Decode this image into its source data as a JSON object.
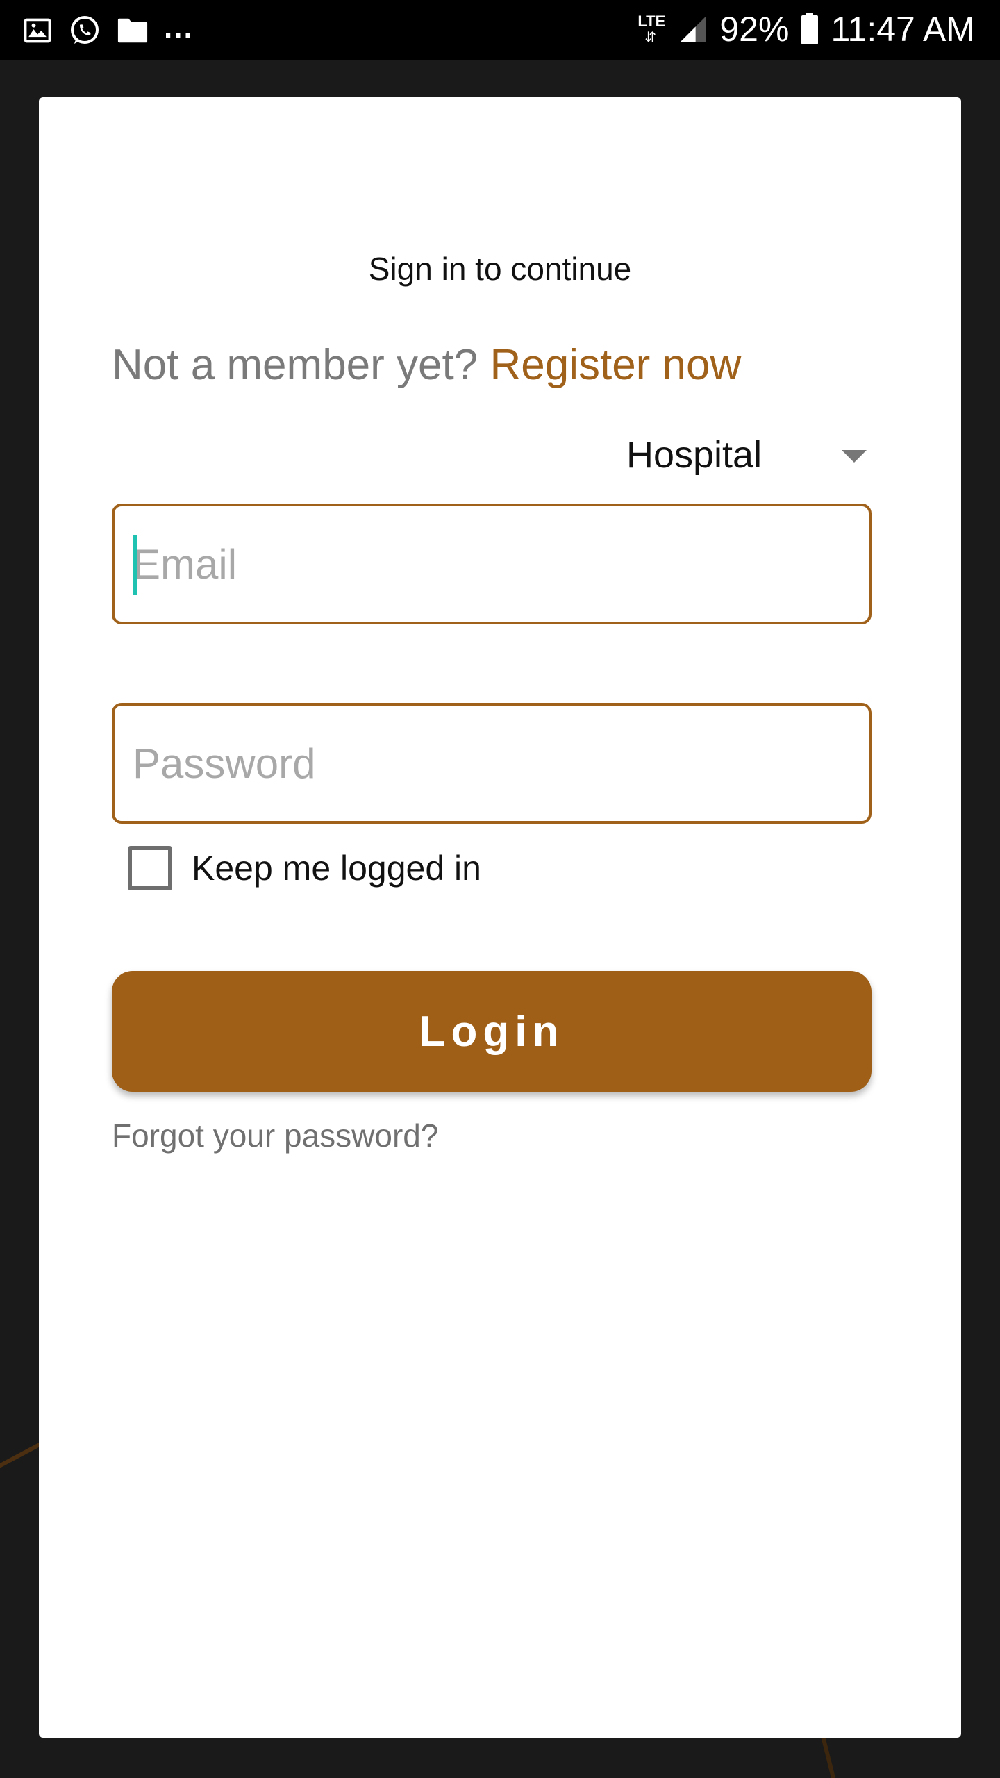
{
  "status_bar": {
    "left_icons": [
      "image-icon",
      "whatsapp-icon",
      "folder-icon"
    ],
    "overflow": "...",
    "network_label": "LTE",
    "battery_percent": "92%",
    "time": "11:47 AM"
  },
  "dialog": {
    "subtitle": "Sign in to continue",
    "member_prompt": "Not a member yet?",
    "register_link": "Register now",
    "user_type": {
      "selected": "Hospital"
    },
    "email": {
      "placeholder": "Email",
      "value": ""
    },
    "password": {
      "placeholder": "Password",
      "value": ""
    },
    "keep_logged_in": {
      "label": "Keep me logged in",
      "checked": false
    },
    "login_button": "Login",
    "forgot_link": "Forgot your password?"
  },
  "colors": {
    "accent": "#9f5f17",
    "link": "#a0611a",
    "cursor": "#1fc2b0"
  }
}
